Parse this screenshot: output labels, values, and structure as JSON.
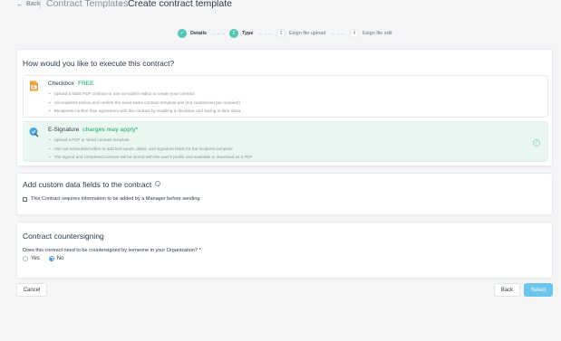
{
  "header": {
    "back_label": "Back",
    "parent": "Contract Templates",
    "title": "Create contract template"
  },
  "stepper": [
    {
      "num": "✓",
      "label": "Details",
      "state": "done"
    },
    {
      "num": "2",
      "label": "Type",
      "state": "active"
    },
    {
      "num": "3",
      "label": "Esign file upload",
      "state": "pending"
    },
    {
      "num": "4",
      "label": "Esign file edit",
      "state": "pending"
    }
  ],
  "execute": {
    "title": "How would you like to execute this contract?",
    "options": [
      {
        "name": "Checkbox",
        "note": "FREE",
        "icon": "pdf-document-icon",
        "selected": false,
        "bullets": [
          "Upload a static PDF contract or use our built-in editor to create your contract",
          "All recipients review and confirm the exact same contract template text (not customised per recipient)",
          "Recipients confirm their agreement with the contract by enabling a checkbox and saving in their inbox"
        ]
      },
      {
        "name": "E-Signature",
        "note": "charges may apply*",
        "icon": "esignature-icon",
        "selected": true,
        "bullets": [
          "Upload a PDF or Word contract template",
          "Use our embedded editor to add text inputs, dates, and signature fields for the recipient complete",
          "The signed and completed contract will be stored with the user's profile and available to download as a PDF"
        ]
      }
    ]
  },
  "custom_fields": {
    "title": "Add custom data fields to the contract",
    "checkbox_label": "This Contract requires information to be added by a Manager before sending"
  },
  "countersign": {
    "title": "Contract countersigning",
    "question": "Does this contract need to be countersigned by someone in your Organization? *",
    "options": [
      "Yes",
      "No"
    ],
    "selected": "No"
  },
  "footer": {
    "cancel_label": "Cancel",
    "back_label": "Back",
    "select_label": "Select"
  },
  "colors": {
    "accent_teal": "#56c5b6",
    "free_green": "#4cbf8b",
    "primary_button": "#6cc5ea",
    "selected_row": "#eaf7f1"
  }
}
